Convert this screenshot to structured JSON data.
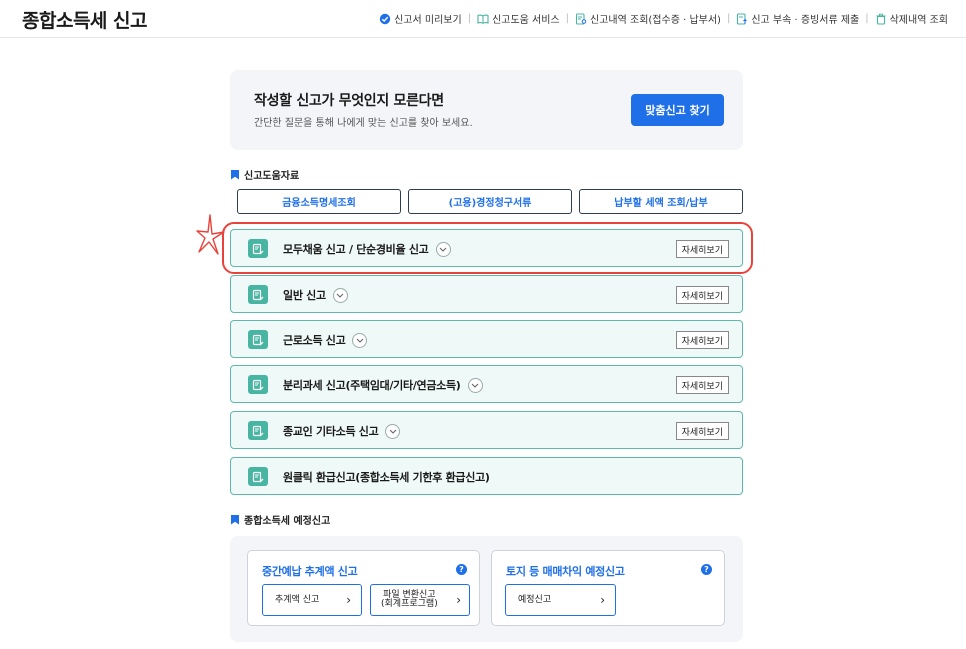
{
  "header": {
    "title": "종합소득세 신고",
    "nav": [
      {
        "label": "신고서 미리보기",
        "icon": "check-circle-icon"
      },
      {
        "label": "신고도움 서비스",
        "icon": "book-icon"
      },
      {
        "label": "신고내역 조회(접수증 · 납부서)",
        "icon": "document-search-icon"
      },
      {
        "label": "신고 부속 · 증빙서류 제출",
        "icon": "document-upload-icon"
      },
      {
        "label": "삭제내역 조회",
        "icon": "trash-icon"
      }
    ]
  },
  "banner": {
    "title": "작성할 신고가 무엇인지 모른다면",
    "subtitle": "간단한 질문을 통해 나에게 맞는 신고를 찾아 보세요.",
    "button": "맞춤신고 찾기"
  },
  "help_section": {
    "heading": "신고도움자료",
    "buttons": [
      "금융소득명세조회",
      "(고용)경정청구서류",
      "납부할 세액 조회/납부"
    ]
  },
  "filing_rows": [
    {
      "label": "모두채움 신고 / 단순경비율 신고",
      "has_toggle": true,
      "detail": "자세히보기"
    },
    {
      "label": "일반 신고",
      "has_toggle": true,
      "detail": "자세히보기"
    },
    {
      "label": "근로소득 신고",
      "has_toggle": true,
      "detail": "자세히보기"
    },
    {
      "label": "분리과세 신고(주택임대/기타/연금소득)",
      "has_toggle": true,
      "detail": "자세히보기"
    },
    {
      "label": "종교인 기타소득 신고",
      "has_toggle": true,
      "detail": "자세히보기"
    },
    {
      "label": "원클릭 환급신고(종합소득세 기한후 환급신고)",
      "has_toggle": false,
      "detail": ""
    }
  ],
  "estimate_section": {
    "heading": "종합소득세 예정신고",
    "cards": [
      {
        "title": "중간예납 추계액 신고",
        "buttons": [
          "추계액 신고",
          "파일 변환신고\n(회계프로그램)"
        ]
      },
      {
        "title": "토지 등 매매차익 예정신고",
        "buttons": [
          "예정신고"
        ]
      }
    ]
  },
  "colors": {
    "accent": "#1f6fe8",
    "row_border": "#5fb8ac",
    "row_bg": "#eff9f7",
    "highlight": "#e8433a"
  }
}
